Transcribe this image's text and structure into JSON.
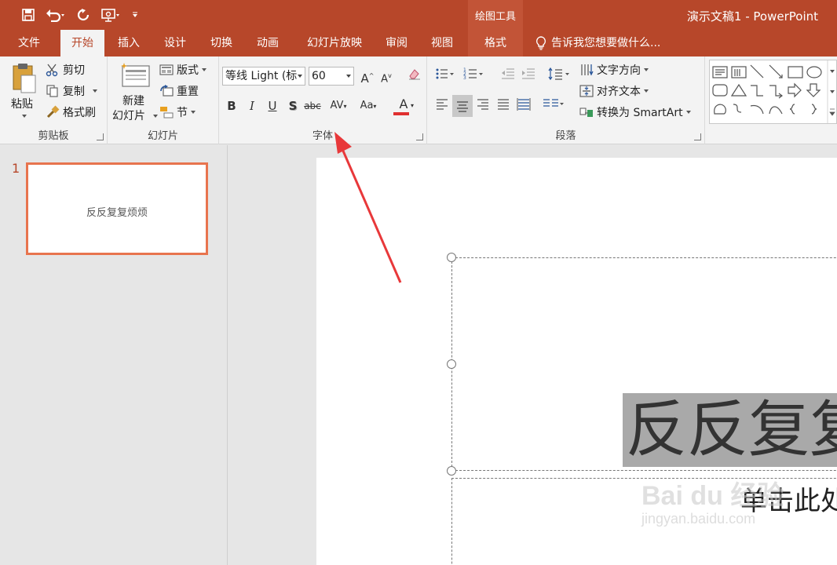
{
  "titlebar": {
    "context_group": "绘图工具",
    "doc_title": "演示文稿1 - PowerPoint"
  },
  "tabs": [
    {
      "label": "文件"
    },
    {
      "label": "开始"
    },
    {
      "label": "插入"
    },
    {
      "label": "设计"
    },
    {
      "label": "切换"
    },
    {
      "label": "动画"
    },
    {
      "label": "幻灯片放映"
    },
    {
      "label": "审阅"
    },
    {
      "label": "视图"
    },
    {
      "label": "格式"
    }
  ],
  "tellme": "告诉我您想要做什么...",
  "clipboard": {
    "paste": "粘贴",
    "cut": "剪切",
    "copy": "复制",
    "format_painter": "格式刷",
    "label": "剪贴板"
  },
  "slides_group": {
    "new_slide_1": "新建",
    "new_slide_2": "幻灯片",
    "layout": "版式",
    "reset": "重置",
    "section": "节",
    "label": "幻灯片"
  },
  "font": {
    "font_name": "等线 Light (标",
    "font_size": "60",
    "label": "字体",
    "font_color": "#e03030"
  },
  "paragraph": {
    "text_direction": "文字方向",
    "align_text": "对齐文本",
    "convert_smartart": "转换为 SmartArt",
    "label": "段落"
  },
  "slides_panel": {
    "number": "1",
    "thumb_text": "反反复复烦烦"
  },
  "slide": {
    "title_text": "反反复复",
    "subtitle_text": "单击此处"
  },
  "watermark": {
    "brand": "Bai du 经验",
    "url": "jingyan.baidu.com"
  },
  "colors": {
    "accent": "#b7472a",
    "thumb_border": "#e8744e",
    "arrow": "#e8383a"
  }
}
